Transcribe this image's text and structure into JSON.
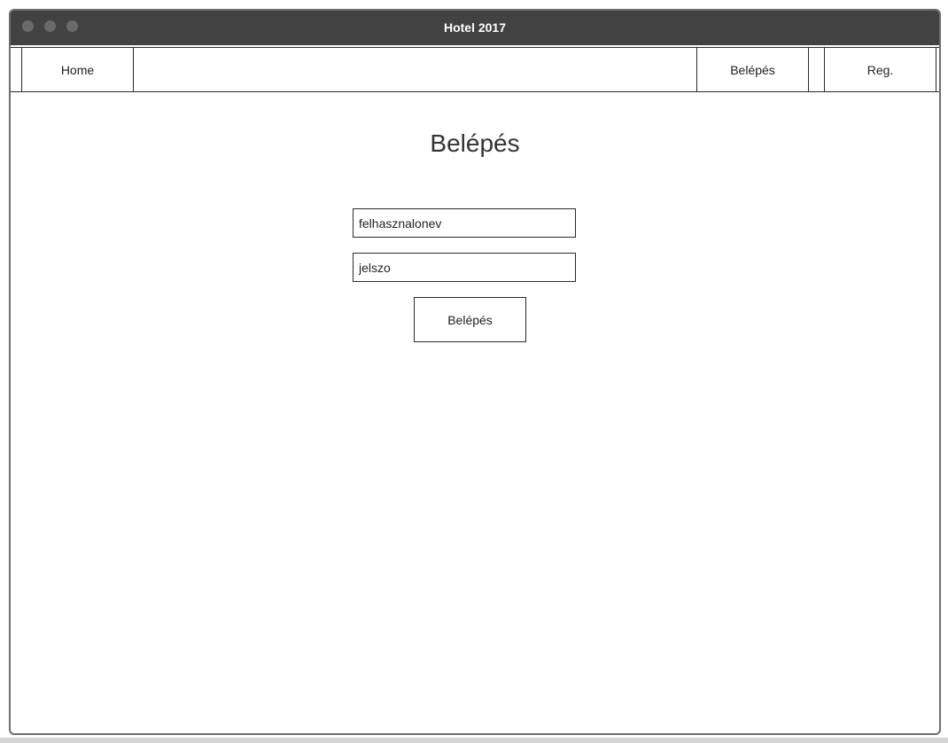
{
  "window": {
    "title": "Hotel 2017",
    "titlebar_color": "#424242",
    "traffic_light_color": "#6a6a6a"
  },
  "nav": {
    "home_label": "Home",
    "login_label": "Belépés",
    "register_label": "Reg."
  },
  "login_form": {
    "heading": "Belépés",
    "username_value": "felhasznalonev",
    "password_value": "jelszo",
    "submit_label": "Belépés"
  }
}
